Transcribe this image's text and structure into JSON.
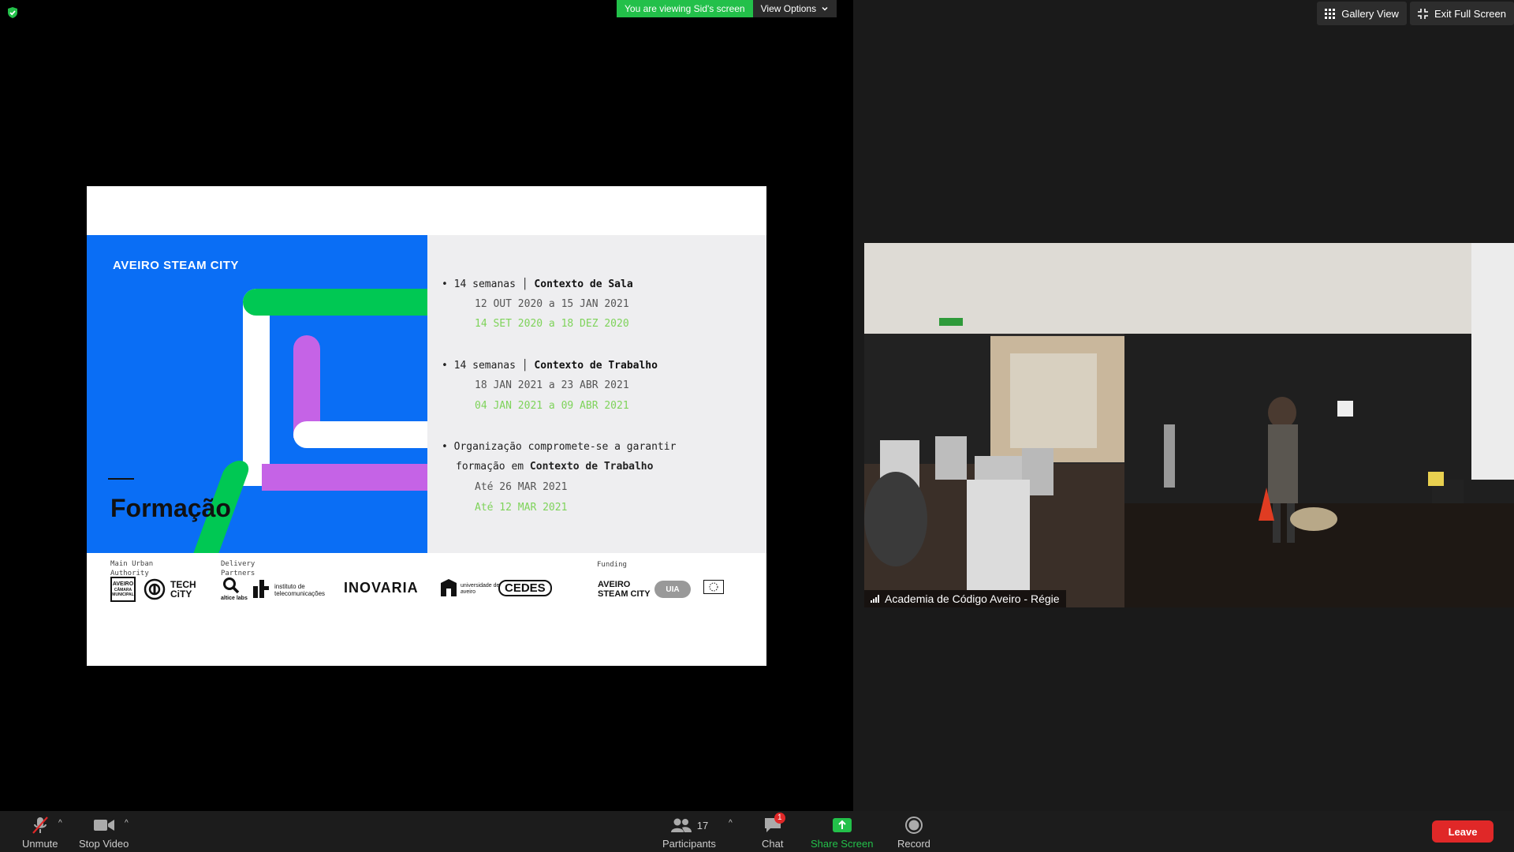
{
  "banner": {
    "viewing_text": "You are viewing Sid's screen",
    "view_options": "View Options"
  },
  "slide": {
    "brand": "AVEIRO STEAM CITY",
    "title": "Formação",
    "items": [
      {
        "prefix": "14 semanas",
        "bold": "Contexto de Sala",
        "date_old": "12 OUT 2020  a 15 JAN 2021",
        "date_new": "14 SET 2020 a 18 DEZ 2020"
      },
      {
        "prefix": "14 semanas",
        "bold": "Contexto de Trabalho",
        "date_old": "18 JAN 2021 a 23 ABR 2021",
        "date_new": "04 JAN 2021 a 09 ABR 2021"
      }
    ],
    "item3_line1": "Organização compromete-se a garantir",
    "item3_line2_prefix": "formação em ",
    "item3_line2_bold": "Contexto de Trabalho",
    "item3_date_old": "Até 26 MAR 2021",
    "item3_date_new": "Até 12 MAR 2021",
    "footer": {
      "label_main": "Main Urban Authority",
      "label_delivery": "Delivery Partners",
      "label_funding": "Funding",
      "logo_aveiro": "AVEIRO",
      "logo_camara": "CÂMARA MUNICIPAL",
      "logo_techcity": "TECH CiTY",
      "logo_altice": "altice labs",
      "logo_it": "instituto de telecomunicações",
      "logo_inovaria": "INOVARIA",
      "logo_ua": "universidade de aveiro",
      "logo_cedes": "CEDES",
      "logo_steam": "AVEIRO STEAM CITY",
      "logo_uia": "UIA"
    }
  },
  "right": {
    "gallery_view": "Gallery View",
    "exit_full_screen": "Exit Full Screen",
    "participant_name": "Academia de Código Aveiro - Régie"
  },
  "toolbar": {
    "unmute": "Unmute",
    "stop_video": "Stop Video",
    "participants": "Participants",
    "participants_count": "17",
    "chat": "Chat",
    "chat_badge": "1",
    "share_screen": "Share Screen",
    "record": "Record",
    "leave": "Leave"
  },
  "colors": {
    "zoom_green": "#23c04a",
    "leave_red": "#e02828",
    "slide_blue": "#0a6ef5",
    "slide_green": "#00c853",
    "slide_purple": "#c563e6"
  }
}
